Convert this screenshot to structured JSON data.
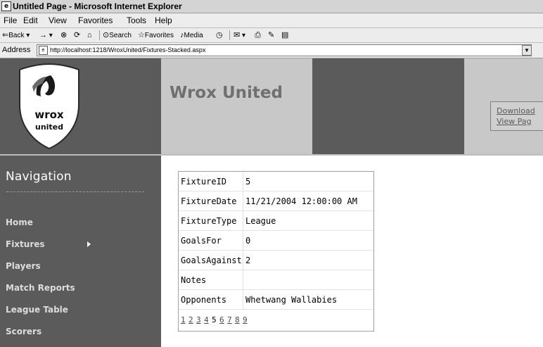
{
  "window": {
    "title": "Untitled Page - Microsoft Internet Explorer"
  },
  "menu": [
    "File",
    "Edit",
    "View",
    "Favorites",
    "Tools",
    "Help"
  ],
  "toolbar": {
    "back": "Back",
    "search": "Search",
    "favorites": "Favorites",
    "media": "Media"
  },
  "address": {
    "label": "Address",
    "url": "http://localhost:1218/WroxUnited/Fixtures-Stacked.aspx"
  },
  "header": {
    "site_title": "Wrox United",
    "logo_text": [
      "wrox",
      "united"
    ],
    "links": [
      "Download",
      "View Pag"
    ]
  },
  "nav": {
    "heading": "Navigation",
    "items": [
      "Home",
      "Fixtures",
      "Players",
      "Match Reports",
      "League Table",
      "Scorers"
    ]
  },
  "details": {
    "rows": [
      {
        "field": "FixtureID",
        "value": "5"
      },
      {
        "field": "FixtureDate",
        "value": "11/21/2004 12:00:00 AM"
      },
      {
        "field": "FixtureType",
        "value": "League"
      },
      {
        "field": "GoalsFor",
        "value": "0"
      },
      {
        "field": "GoalsAgainst",
        "value": "2"
      },
      {
        "field": "Notes",
        "value": ""
      },
      {
        "field": "Opponents",
        "value": "Whetwang Wallabies"
      }
    ],
    "pager": [
      "1",
      "2",
      "3",
      "4",
      "5",
      "6",
      "7",
      "8",
      "9"
    ],
    "current_page": "5"
  },
  "colors": {
    "dark_panel": "#5b5b5b",
    "light_panel": "#c8c8c8",
    "title_text": "#707070"
  }
}
